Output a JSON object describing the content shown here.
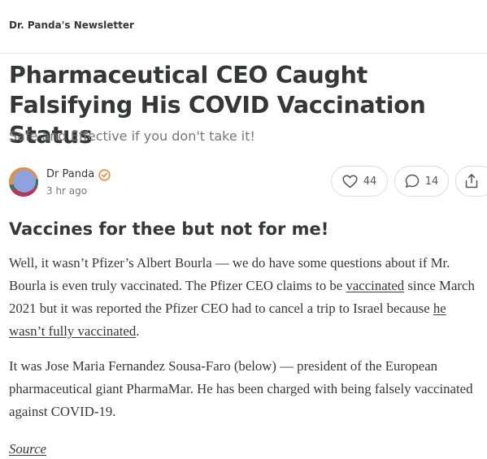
{
  "header": {
    "publication_name": "Dr. Panda's Newsletter"
  },
  "post": {
    "title": "Pharmaceutical CEO Caught Falsifying His COVID Vaccination Status",
    "subtitle": "Safe and Effective if you don't take it!",
    "author": "Dr Panda",
    "time": "3 hr ago",
    "likes": "44",
    "comments": "14"
  },
  "body": {
    "heading": "Vaccines for thee but not for me!",
    "paragraph_1": {
      "part_1": "Well, it wasn’t Pfizer’s Albert Bourla — we do have some questions about if Mr. Bourla is even truly vaccinated. The Pfizer CEO claims to be ",
      "link_1": "vaccinated",
      "part_2": " since March 2021 but it was reported the Pfizer CEO had to cancel a trip to Israel because ",
      "link_2": "he wasn’t fully vaccinated",
      "part_3": "."
    },
    "paragraph_2": "It was Jose Maria Fernandez Sousa-Faro (below) — president of the European pharmaceutical giant PharmaMar. He has been charged with being falsely vaccinated against COVID-19.",
    "source_link": "Source"
  },
  "icons": {
    "verified": "verified-badge-icon",
    "like": "heart-icon",
    "comment": "comment-bubble-icon",
    "share": "share-icon"
  },
  "colors": {
    "text": "#363737",
    "muted": "#777777",
    "verified_badge": "#e8883a",
    "pill_border": "#dcdcdc"
  }
}
